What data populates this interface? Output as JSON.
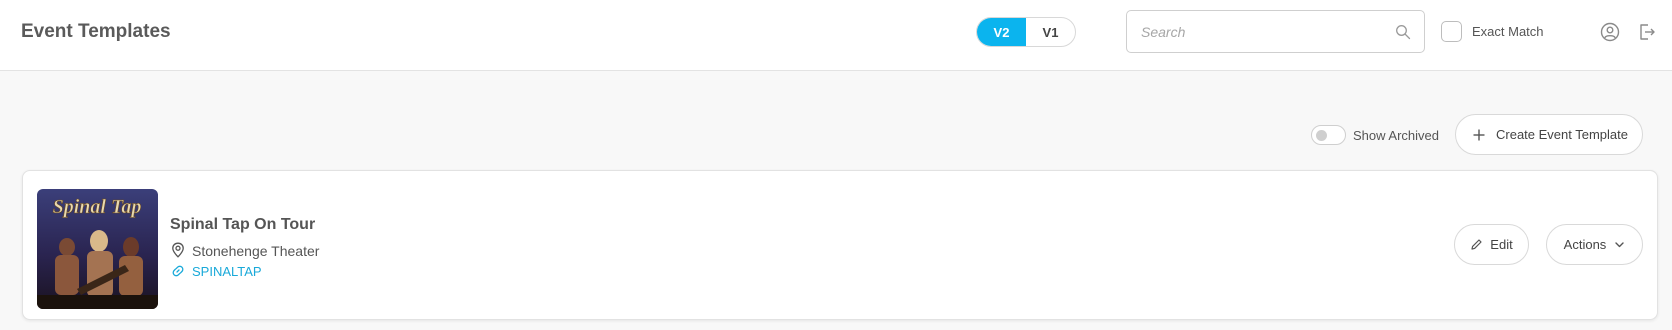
{
  "header": {
    "title": "Event Templates",
    "version_toggle": {
      "options": [
        "V2",
        "V1"
      ],
      "selected": "V2",
      "active_color": "#0bb4ee"
    },
    "search": {
      "placeholder": "Search",
      "value": ""
    },
    "exact_match": {
      "label": "Exact Match",
      "checked": false
    },
    "icons": [
      "user-icon",
      "logout-icon"
    ]
  },
  "toolbar": {
    "show_archived": {
      "label": "Show Archived",
      "on": false
    },
    "create_label": "Create Event Template"
  },
  "events": [
    {
      "name": "Spinal Tap On Tour",
      "venue": "Stonehenge Theater",
      "slug": "SPINALTAP",
      "poster_logo": "Spinal Tap",
      "edit_label": "Edit",
      "actions_label": "Actions"
    }
  ],
  "colors": {
    "accent": "#0bb4ee",
    "link": "#19a9d9"
  }
}
